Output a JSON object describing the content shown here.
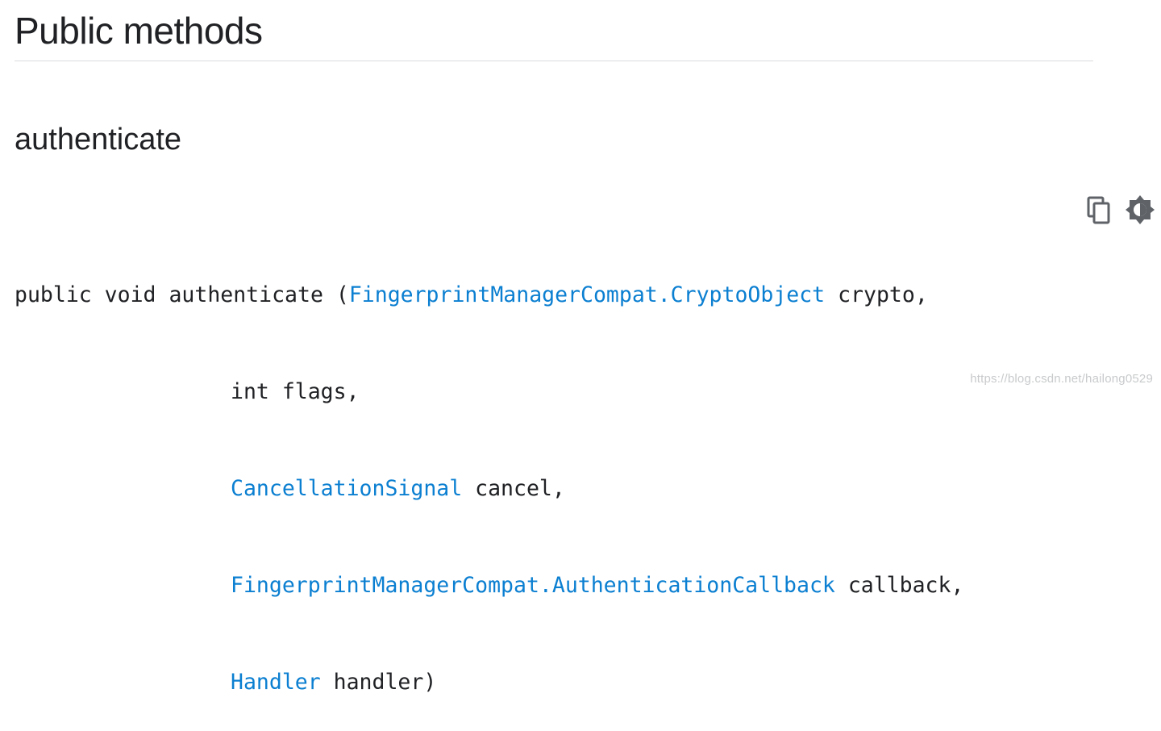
{
  "page": {
    "section_title": "Public methods",
    "method_title": "authenticate"
  },
  "signature": {
    "line1": {
      "prefix": "public void authenticate (",
      "type": "FingerprintManagerCompat.CryptoObject",
      "param": " crypto,"
    },
    "line2": {
      "text": "int flags,"
    },
    "line3": {
      "type": "CancellationSignal",
      "param": " cancel,"
    },
    "line4": {
      "type": "FingerprintManagerCompat.AuthenticationCallback",
      "param": " callback,"
    },
    "line5": {
      "type": "Handler",
      "param": " handler)"
    }
  },
  "toolbar": {
    "copy_icon": "copy-icon",
    "theme_icon": "brightness-icon"
  },
  "colors": {
    "link": "#0b7fd1",
    "text": "#202124",
    "divider": "#dadce0"
  },
  "watermark": "https://blog.csdn.net/hailong0529"
}
